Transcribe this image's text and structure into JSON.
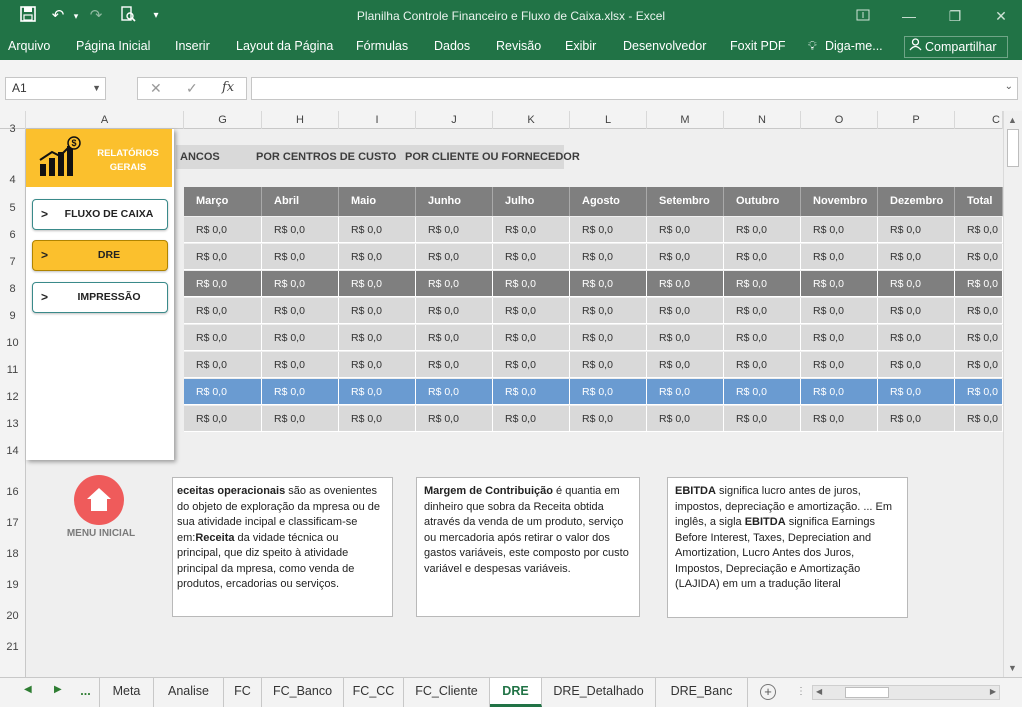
{
  "window": {
    "title": "Planilha Controle Financeiro e Fluxo de Caixa.xlsx - Excel"
  },
  "ribbon": {
    "tabs": [
      "Arquivo",
      "Página Inicial",
      "Inserir",
      "Layout da Página",
      "Fórmulas",
      "Dados",
      "Revisão",
      "Exibir",
      "Desenvolvedor",
      "Foxit PDF",
      "Diga-me..."
    ],
    "share_label": "Compartilhar"
  },
  "formula_bar": {
    "name_box": "A1",
    "fx": "fx",
    "formula": ""
  },
  "columns": [
    "A",
    "G",
    "H",
    "I",
    "J",
    "K",
    "L",
    "M",
    "N",
    "O",
    "P",
    "C"
  ],
  "rows": [
    "3",
    "4",
    "5",
    "6",
    "7",
    "8",
    "9",
    "10",
    "11",
    "12",
    "13",
    "14",
    "16",
    "17",
    "18",
    "19",
    "20",
    "21"
  ],
  "report_tabs": [
    "ANCOS",
    "POR CENTROS DE CUSTOS",
    "POR CLIENTE OU FORNECEDOR"
  ],
  "months": [
    "Março",
    "Abril",
    "Maio",
    "Junho",
    "Julho",
    "Agosto",
    "Setembro",
    "Outubro",
    "Novembro",
    "Dezembro",
    "Total"
  ],
  "cell_value": "R$ 0,0",
  "side_panel": {
    "header": "RELATÓRIOS GERAIS",
    "buttons": [
      {
        "marker": ">",
        "label": "FLUXO DE CAIXA"
      },
      {
        "marker": ">",
        "label": "DRE"
      },
      {
        "marker": ">",
        "label": "IMPRESSÃO"
      }
    ]
  },
  "home": {
    "label": "MENU INICIAL"
  },
  "notes": {
    "receitas": {
      "b1": "eceitas operacionais",
      "t1": " são as ovenientes do objeto de exploração da mpresa ou de sua atividade incipal e classificam-se em:",
      "b2": "Receita",
      "t2": " da vidade técnica ou principal, que diz speito à atividade principal da mpresa, como venda de produtos, ercadorias ou serviços."
    },
    "margem": {
      "b1": "Margem de Contribuição",
      "t1": " é quantia em dinheiro que sobra da Receita obtida através da venda de um produto, serviço ou mercadoria após retirar o valor dos gastos variáveis, este composto por custo variável e despesas variáveis."
    },
    "ebitda": {
      "b1": "EBITDA",
      "t1": " significa lucro antes de juros, impostos, depreciação e amortização. ... Em inglês, a sigla ",
      "b2": "EBITDA",
      "t2": " significa Earnings Before Interest, Taxes, Depreciation and Amortization, Lucro Antes dos Juros, Impostos, Depreciação e Amortização (LAJIDA) em um a tradução literal"
    }
  },
  "sheet_tabs": [
    "...",
    "Meta",
    "Analise",
    "FC",
    "FC_Banco",
    "FC_CC",
    "FC_Cliente",
    "DRE",
    "DRE_Detalhado",
    "DRE_Banc"
  ],
  "active_sheet": "DRE",
  "colors": {
    "excel_green": "#217346",
    "gold": "#fbc02d",
    "header_gray": "#7f7f7f",
    "row_dark": "#7f7f7f",
    "row_light": "#d9d9d9",
    "row_selected": "#6a9bd1",
    "home_red": "#ef5b5b"
  }
}
